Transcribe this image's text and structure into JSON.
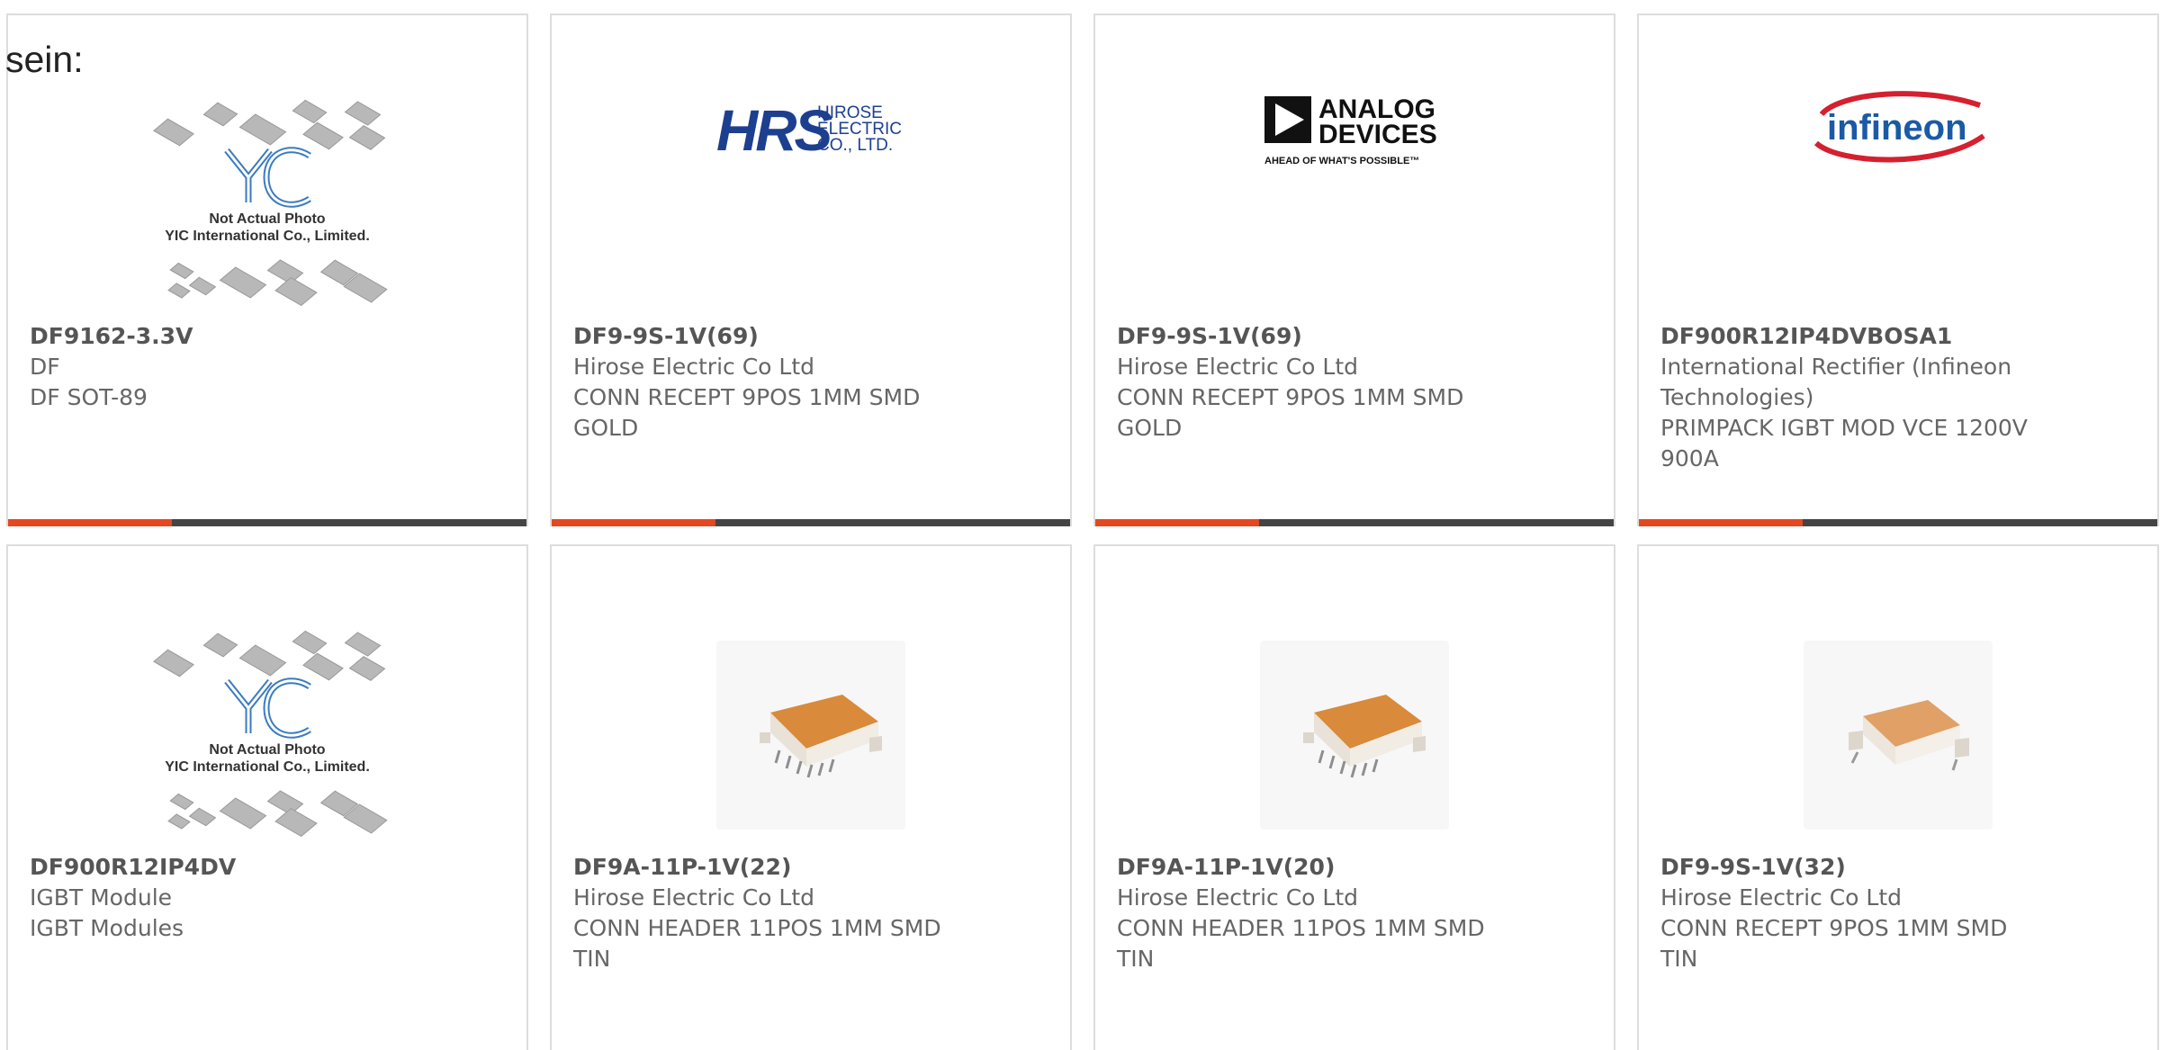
{
  "intro": {
    "text": "sein:"
  },
  "colors": {
    "accent": "#e5471f",
    "bar": "#444444",
    "border": "#dddddd",
    "text": "#666666"
  },
  "placeholder": {
    "line1": "Not Actual Photo",
    "line2": "YIC International Co., Limited."
  },
  "logos": {
    "hrs": {
      "mark": "HRS",
      "line1": "HIROSE",
      "line2": "ELECTRIC",
      "line3": "CO., LTD."
    },
    "adi": {
      "line1": "ANALOG",
      "line2": "DEVICES",
      "tagline": "AHEAD OF WHAT'S POSSIBLE™"
    },
    "infineon": {
      "name": "infineon"
    }
  },
  "cards": [
    {
      "part": "DF9162-3.3V",
      "lines": [
        "DF",
        "DF SOT-89"
      ],
      "image": "placeholder-icon"
    },
    {
      "part": "DF9-9S-1V(69)",
      "lines": [
        "Hirose Electric Co Ltd",
        "CONN RECEPT 9POS 1MM SMD",
        "GOLD"
      ],
      "image": "hirose-logo-icon"
    },
    {
      "part": "DF9-9S-1V(69)",
      "lines": [
        "Hirose Electric Co Ltd",
        "CONN RECEPT 9POS 1MM SMD",
        "GOLD"
      ],
      "image": "analog-devices-logo-icon"
    },
    {
      "part": "DF900R12IP4DVBOSA1",
      "lines": [
        "International Rectifier (Infineon",
        "Technologies)",
        "PRIMPACK IGBT MOD VCE 1200V",
        "900A"
      ],
      "image": "infineon-logo-icon"
    },
    {
      "part": "DF900R12IP4DV",
      "lines": [
        "IGBT Module",
        "IGBT Modules"
      ],
      "image": "placeholder-icon"
    },
    {
      "part": "DF9A-11P-1V(22)",
      "lines": [
        "Hirose Electric Co Ltd",
        "CONN HEADER 11POS 1MM SMD",
        "TIN"
      ],
      "image": "connector-photo-icon"
    },
    {
      "part": "DF9A-11P-1V(20)",
      "lines": [
        "Hirose Electric Co Ltd",
        "CONN HEADER 11POS 1MM SMD",
        "TIN"
      ],
      "image": "connector-photo-icon"
    },
    {
      "part": "DF9-9S-1V(32)",
      "lines": [
        "Hirose Electric Co Ltd",
        "CONN RECEPT 9POS 1MM SMD",
        "TIN"
      ],
      "image": "connector-photo-icon"
    }
  ]
}
